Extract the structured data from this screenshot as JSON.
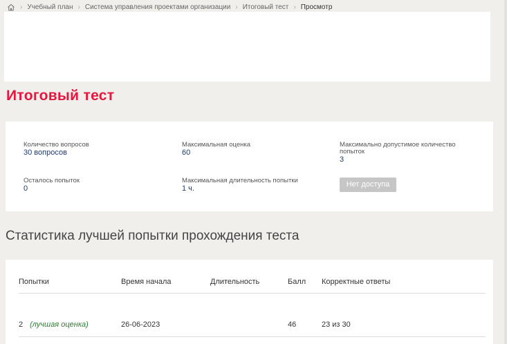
{
  "breadcrumb": {
    "items": [
      "Учебный план",
      "Система управления проектами организации",
      "Итоговый тест",
      "Просмотр"
    ]
  },
  "page": {
    "title": "Итоговый тест"
  },
  "test_info": {
    "questions_label": "Количество вопросов",
    "questions_value": "30 вопросов",
    "max_score_label": "Максимальная оценка",
    "max_score_value": "60",
    "max_attempts_label_line1": "Максимально допустимое количество",
    "max_attempts_label_line2": "попыток",
    "max_attempts_value": "3",
    "remaining_label": "Осталось попыток",
    "remaining_value": "0",
    "max_duration_label": "Максимальная длительность попытки",
    "max_duration_value": "1 ч.",
    "no_access_button": "Нет доступа"
  },
  "stats": {
    "title": "Статистика лучшей попытки прохождения теста",
    "columns": [
      "Попытки",
      "Время начала",
      "Длительность",
      "Балл",
      "Корректные ответы"
    ],
    "rows": [
      {
        "attempt": "2",
        "best_label": "(лучшая оценка)",
        "start_time": "26-06-2023",
        "duration": "",
        "score": "46",
        "correct": "23 из 30"
      }
    ]
  },
  "colors": {
    "accent": "#e5173f",
    "value_text": "#1f3c6b",
    "best_label": "#2e7d32",
    "disabled_button": "#c6c6c6"
  }
}
